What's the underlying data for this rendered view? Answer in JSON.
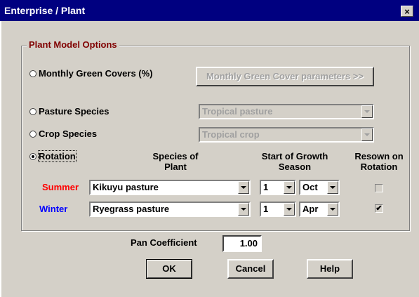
{
  "window": {
    "title": "Enterprise / Plant",
    "close_glyph": "×"
  },
  "group": {
    "legend": "Plant Model Options"
  },
  "options": {
    "monthly": {
      "label": "Monthly Green Covers (%)",
      "selected": false,
      "button_label": "Monthly Green Cover parameters >>"
    },
    "pasture": {
      "label": "Pasture Species",
      "selected": false,
      "value": "Tropical pasture"
    },
    "crop": {
      "label": "Crop Species",
      "selected": false,
      "value": "Tropical crop"
    },
    "rotation": {
      "label": "Rotation",
      "selected": true
    }
  },
  "headers": {
    "species_line1": "Species of",
    "species_line2": "Plant",
    "start_line1": "Start of Growth",
    "start_line2": "Season",
    "resown_line1": "Resown on",
    "resown_line2": "Rotation"
  },
  "rows": [
    {
      "season": "Summer",
      "season_color": "#ff0000",
      "species": "Kikuyu pasture",
      "day": "1",
      "month": "Oct",
      "resown": false,
      "check_glyph": ""
    },
    {
      "season": "Winter",
      "season_color": "#0000ff",
      "species": "Ryegrass pasture",
      "day": "1",
      "month": "Apr",
      "resown": true,
      "check_glyph": "✔"
    }
  ],
  "pan": {
    "label": "Pan Coefficient",
    "value": "1.00"
  },
  "buttons": {
    "ok": "OK",
    "cancel": "Cancel",
    "help": "Help"
  }
}
